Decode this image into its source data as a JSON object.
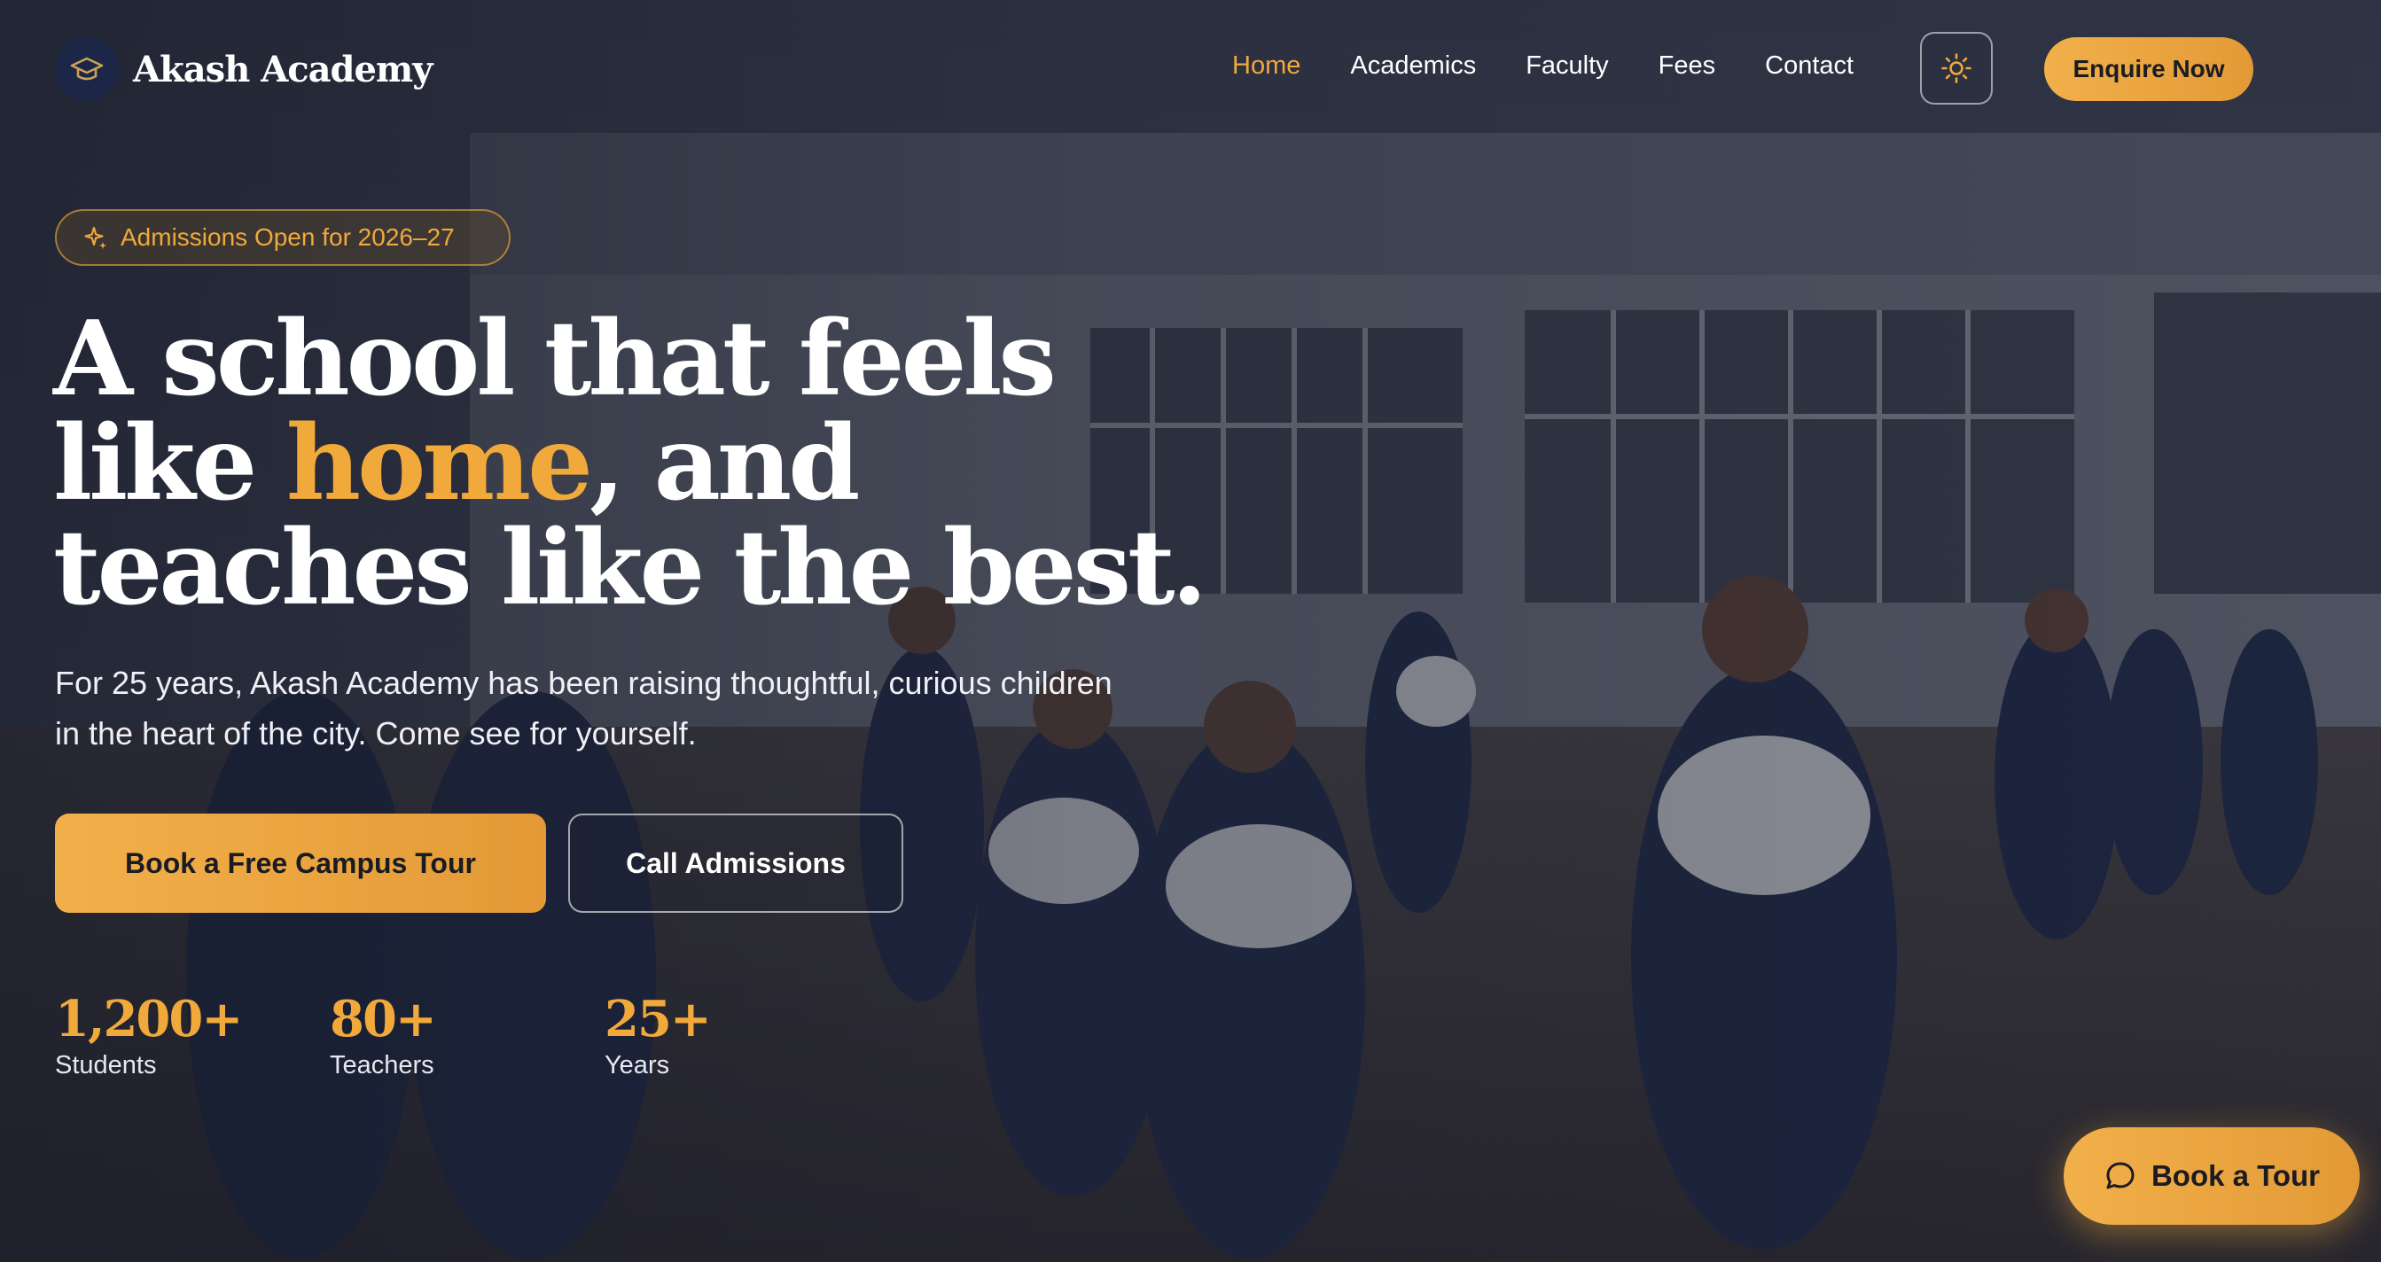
{
  "header": {
    "brand": "Akash Academy",
    "logo_icon": "graduation-cap-icon",
    "nav": [
      {
        "label": "Home",
        "active": true
      },
      {
        "label": "Academics",
        "active": false
      },
      {
        "label": "Faculty",
        "active": false
      },
      {
        "label": "Fees",
        "active": false
      },
      {
        "label": "Contact",
        "active": false
      }
    ],
    "theme_toggle_icon": "sun-icon",
    "enquire_label": "Enquire Now"
  },
  "hero": {
    "badge_icon": "sparkle-icon",
    "badge_text": "Admissions Open for 2026–27",
    "headline_part1": "A school that feels like ",
    "headline_accent": "home",
    "headline_part2": ", and teaches like the best.",
    "subtext": "For 25 years, Akash Academy has been raising thoughtful, curious children in the heart of the city. Come see for yourself.",
    "primary_cta": "Book a Free Campus Tour",
    "secondary_cta": "Call Admissions",
    "stats": [
      {
        "value": "1,200+",
        "label": "Students"
      },
      {
        "value": "80+",
        "label": "Teachers"
      },
      {
        "value": "25+",
        "label": "Years"
      }
    ]
  },
  "floating_button": {
    "icon": "chat-bubble-icon",
    "label": "Book a Tour"
  },
  "colors": {
    "accent": "#f0a93a",
    "logo_badge": "#1c2647",
    "text": "#ffffff"
  }
}
